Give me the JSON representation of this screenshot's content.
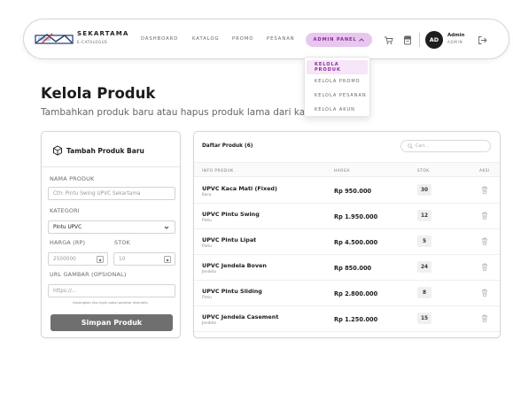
{
  "brand": {
    "name": "SEKARTAMA",
    "sub": "E-CATALOGUE"
  },
  "nav": {
    "links": [
      "DASHBOARD",
      "KATALOG",
      "PROMO",
      "PESANAN"
    ],
    "admin_panel": "ADMIN PANEL"
  },
  "user": {
    "initials": "AD",
    "name": "Admin",
    "role": "ADMIN"
  },
  "dropdown": {
    "items": [
      "KELOLA PRODUK",
      "KELOLA PROMO",
      "KELOLA PESANAN",
      "KELOLA AKUN"
    ],
    "active_index": 0
  },
  "page": {
    "title": "Kelola Produk",
    "subtitle": "Tambahkan produk baru atau hapus produk lama dari katalog."
  },
  "form": {
    "title": "Tambah Produk Baru",
    "name_label": "NAMA PRODUK",
    "name_placeholder": "Cth: Pintu Swing UPVC Sekartama",
    "category_label": "KATEGORI",
    "category_value": "Pintu UPVC",
    "price_label": "HARGA (RP)",
    "price_placeholder": "2500000",
    "stock_label": "STOK",
    "stock_placeholder": "10",
    "image_label": "URL GAMBAR (OPSIONAL)",
    "image_placeholder": "https://...",
    "image_hint": "Kosongkan jika ingin pakai gambar otomatis.",
    "submit_label": "Simpan Produk"
  },
  "table": {
    "title": "Daftar Produk (6)",
    "search_placeholder": "Cari...",
    "headers": [
      "INFO PRODUK",
      "HARGA",
      "STOK",
      "AKSI"
    ],
    "rows": [
      {
        "name": "UPVC Kaca Mati (Fixed)",
        "category": "Kaca",
        "price": "Rp 950.000",
        "stock": "30"
      },
      {
        "name": "UPVC Pintu Swing",
        "category": "Pintu",
        "price": "Rp 1.950.000",
        "stock": "12"
      },
      {
        "name": "UPVC Pintu Lipat",
        "category": "Pintu",
        "price": "Rp 4.500.000",
        "stock": "5"
      },
      {
        "name": "UPVC Jendela Boven",
        "category": "Jendela",
        "price": "Rp 850.000",
        "stock": "24"
      },
      {
        "name": "UPVC Pintu Sliding",
        "category": "Pintu",
        "price": "Rp 2.800.000",
        "stock": "8"
      },
      {
        "name": "UPVC Jendela Casement",
        "category": "Jendela",
        "price": "Rp 1.250.000",
        "stock": "15"
      }
    ]
  },
  "colors": {
    "accent": "#8a2b9a",
    "accent_bg": "#e8c7ee",
    "button": "#6f6f6f"
  },
  "icons": {
    "cart": "cart-icon",
    "receipt": "receipt-icon",
    "logout": "logout-icon",
    "delete": "trash-icon",
    "search": "search-icon",
    "form": "box-plus-icon"
  }
}
